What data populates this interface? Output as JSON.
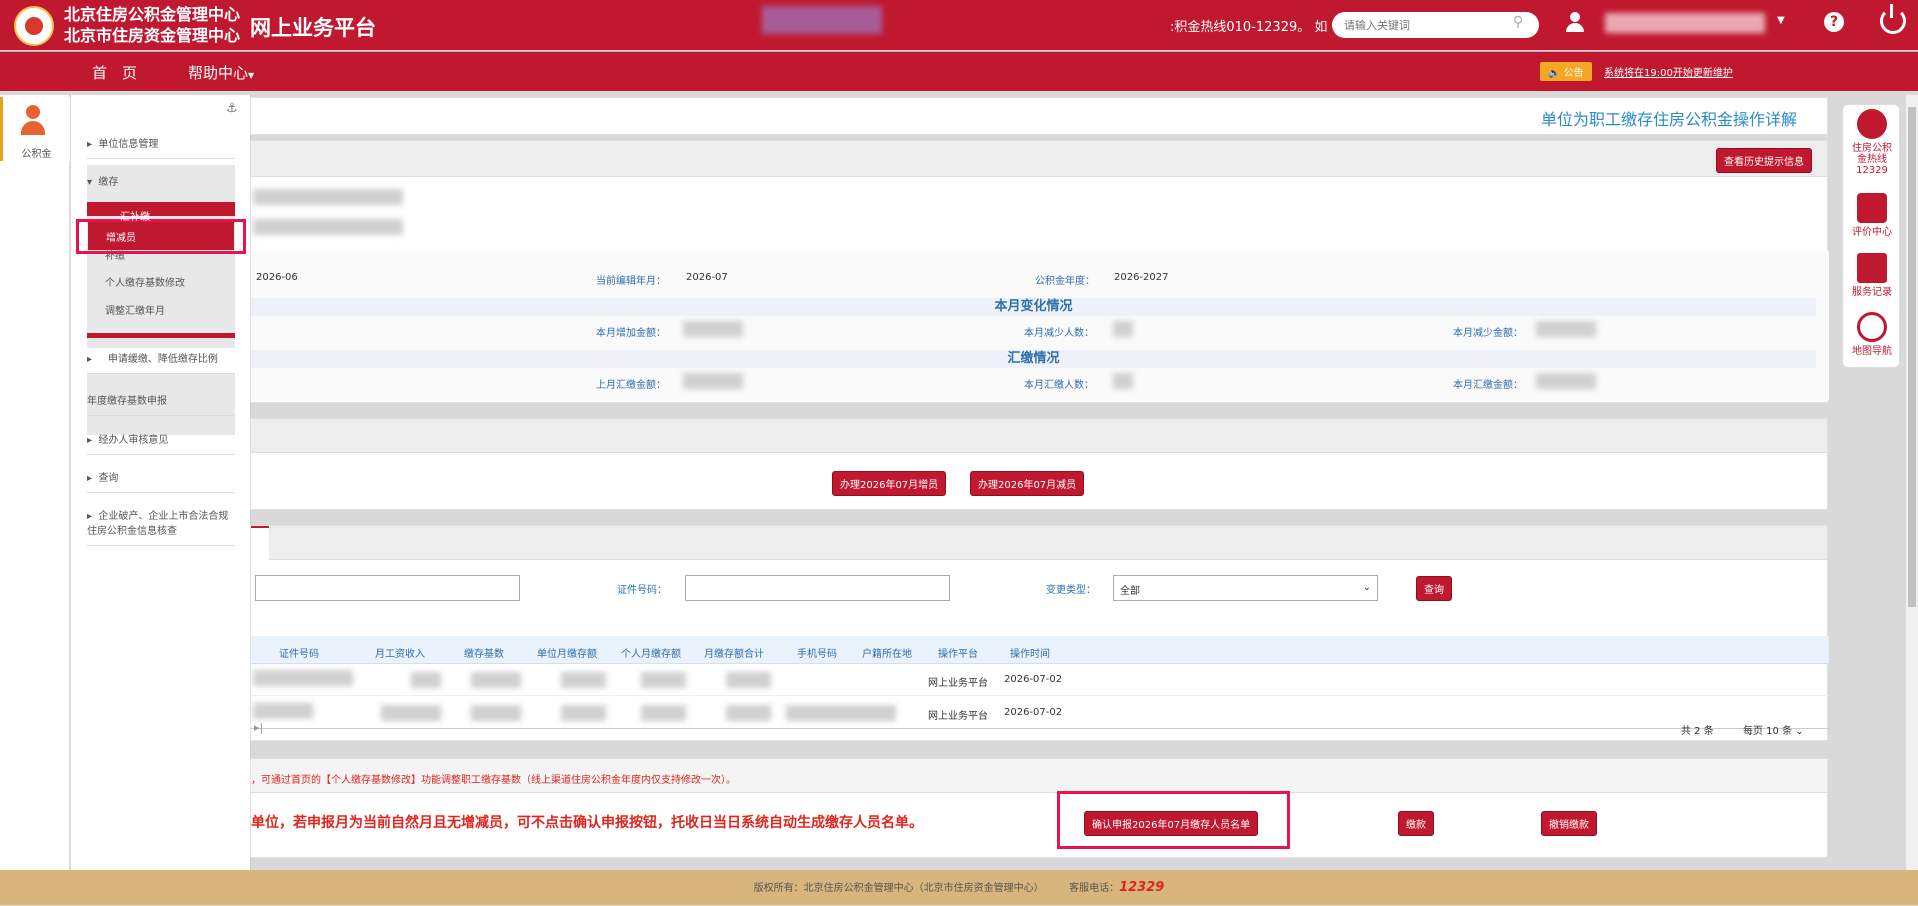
{
  "header": {
    "org_line1": "北京住房公积金管理中心",
    "org_line2": "北京市住房资金管理中心",
    "platform": "网上业务平台",
    "hotline": ":积金热线010-12329。 如",
    "search_placeholder": "请输入关键词"
  },
  "nav": {
    "home": "首　页",
    "help": "帮助中心",
    "notice_badge": "公告",
    "notice_text": "系统将在19:00开始更新维护"
  },
  "left_strip": {
    "gjj_label": "公积金"
  },
  "sidebar": {
    "items": [
      "单位信息管理",
      "缴存",
      "汇补缴",
      "增减员",
      "补缴",
      "个人缴存基数修改",
      "调整汇缴年月",
      "申请缓缴、降低缴存比例",
      "年度缴存基数申报",
      "经办人审核意见",
      "查询",
      "企业破产、企业上市合法合规住房公积金信息核查"
    ]
  },
  "page": {
    "title": "单位为职工缴存住房公积金操作详解",
    "history_btn": "查看历史提示信息"
  },
  "info": {
    "pay_month": "2026-06",
    "edit_label": "当前编辑年月：",
    "edit_value": "2026-07",
    "year_label": "公积金年度：",
    "year_value": "2026-2027",
    "change_title": "本月变化情况",
    "add_amount_label": "本月增加金额：",
    "reduce_count_label": "本月减少人数：",
    "reduce_amount_label": "本月减少金额：",
    "summary_title": "汇缴情况",
    "last_amount_label": "上月汇缴金额：",
    "count_label": "本月汇缴人数：",
    "amount_label": "本月汇缴金额："
  },
  "actions": {
    "add_btn": "办理2026年07月增员",
    "reduce_btn": "办理2026年07月减员"
  },
  "filter": {
    "id_label": "证件号码：",
    "type_label": "变更类型：",
    "type_value": "全部",
    "query_btn": "查询"
  },
  "table": {
    "headers": [
      "证件号码",
      "月工资收入",
      "缴存基数",
      "单位月缴存额",
      "个人月缴存额",
      "月缴存额合计",
      "手机号码",
      "户籍所在地",
      "操作平台",
      "操作时间"
    ],
    "rows": [
      {
        "platform": "网上业务平台",
        "time": "2026-07-02"
      },
      {
        "platform": "网上业务平台",
        "time": "2026-07-02"
      }
    ],
    "total": "共 2 条",
    "per_page": "每页 10 条"
  },
  "bottom": {
    "warn1": "，可通过首页的【个人缴存基数修改】功能调整职工缴存基数（线上渠道住房公积金年度内仅支持修改一次）。",
    "warn2": "单位，若申报月为当前自然月且无增减员，可不点击确认申报按钮，托收日当日系统自动生成缴存人员名单。",
    "confirm_btn": "确认申报2026年07月缴存人员名单",
    "pay_btn": "缴款",
    "cancel_btn": "撤销缴款"
  },
  "rightbar": {
    "hotline": "住房公积金热线12329",
    "evaluate": "评价中心",
    "records": "服务记录",
    "map": "地图导航"
  },
  "footer": {
    "copyright": "版权所有：北京住房公积金管理中心（北京市住房资金管理中心）",
    "service": "客服电话：",
    "phone": "12329"
  }
}
